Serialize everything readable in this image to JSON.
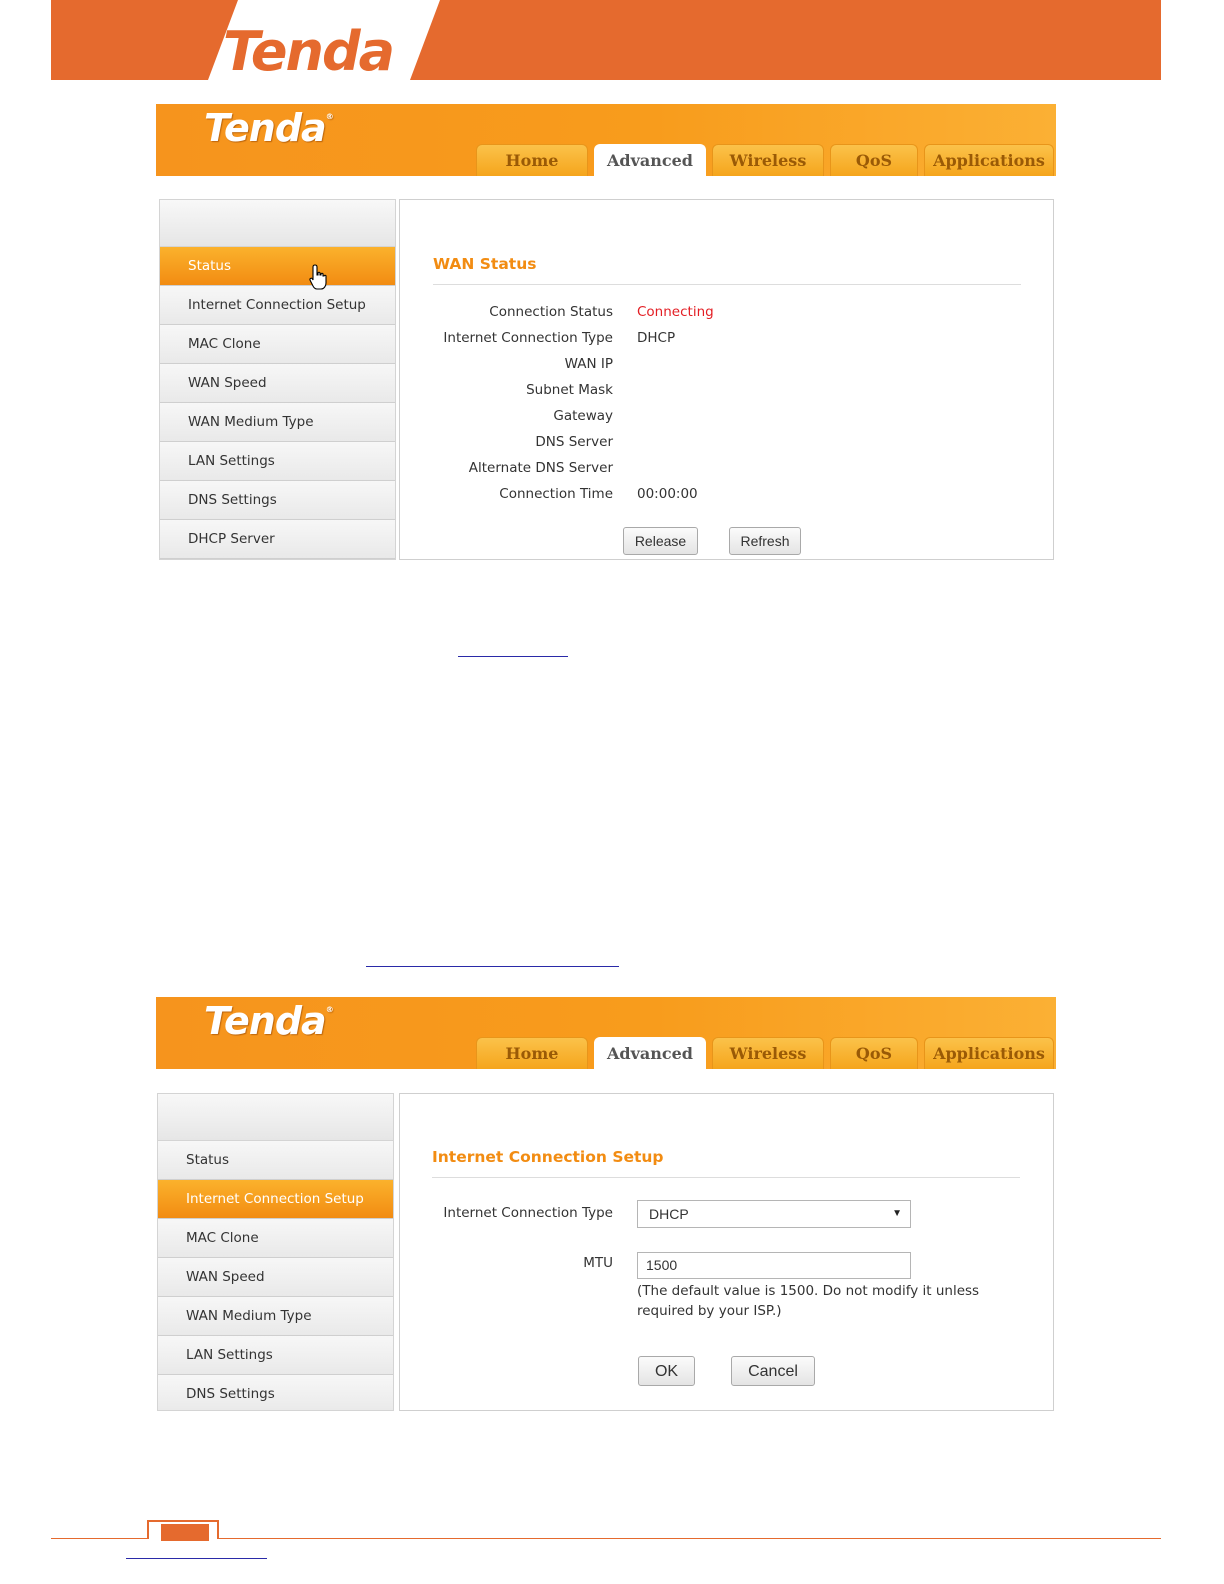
{
  "page": {
    "brand_logo": "Tenda"
  },
  "screen1": {
    "logo": "Tenda",
    "tabs": [
      "Home",
      "Advanced",
      "Wireless",
      "QoS",
      "Applications"
    ],
    "active_tab": "Advanced",
    "sidebar": [
      "Status",
      "Internet Connection Setup",
      "MAC Clone",
      "WAN Speed",
      "WAN Medium Type",
      "LAN Settings",
      "DNS Settings",
      "DHCP Server"
    ],
    "active_item": "Status",
    "title": "WAN Status",
    "rows": [
      {
        "label": "Connection Status",
        "value": "Connecting"
      },
      {
        "label": "Internet Connection Type",
        "value": "DHCP"
      },
      {
        "label": "WAN IP",
        "value": ""
      },
      {
        "label": "Subnet Mask",
        "value": ""
      },
      {
        "label": "Gateway",
        "value": ""
      },
      {
        "label": "DNS Server",
        "value": ""
      },
      {
        "label": "Alternate DNS Server",
        "value": ""
      },
      {
        "label": "Connection Time",
        "value": "00:00:00"
      }
    ],
    "buttons": {
      "release": "Release",
      "refresh": "Refresh"
    }
  },
  "screen2": {
    "logo": "Tenda",
    "tabs": [
      "Home",
      "Advanced",
      "Wireless",
      "QoS",
      "Applications"
    ],
    "active_tab": "Advanced",
    "sidebar": [
      "Status",
      "Internet Connection Setup",
      "MAC Clone",
      "WAN Speed",
      "WAN Medium Type",
      "LAN Settings",
      "DNS Settings"
    ],
    "active_item": "Internet Connection Setup",
    "title": "Internet Connection Setup",
    "type_label": "Internet Connection Type",
    "type_value": "DHCP",
    "mtu_label": "MTU",
    "mtu_value": "1500",
    "mtu_note": "(The default value is 1500. Do not modify it unless required by your ISP.)",
    "buttons": {
      "ok": "OK",
      "cancel": "Cancel"
    }
  },
  "colors": {
    "brand_orange": "#e56a2e",
    "ui_orange": "#f6941d",
    "accent_text": "#f28c12",
    "status_red": "#e31e24"
  }
}
